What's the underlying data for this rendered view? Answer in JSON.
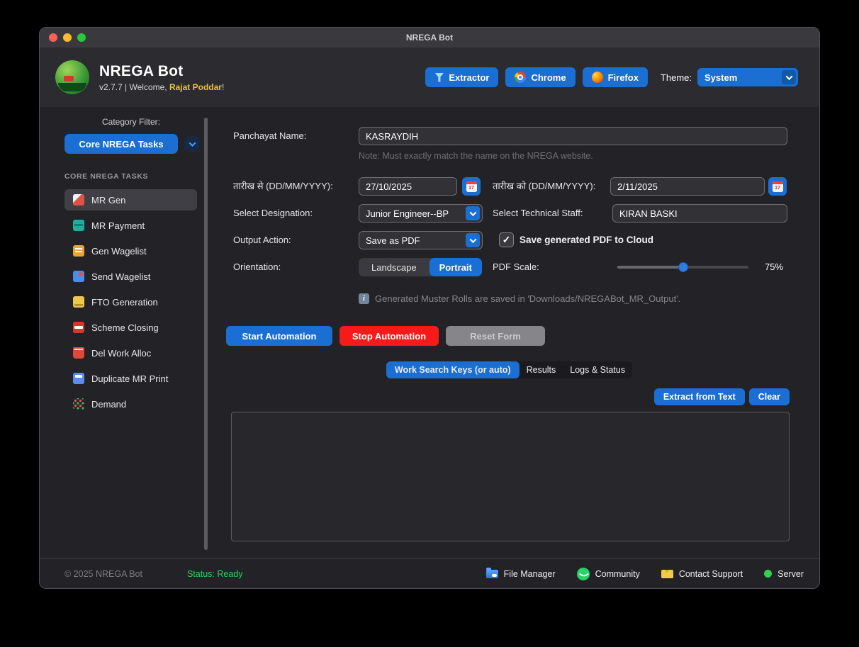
{
  "window": {
    "title": "NREGA Bot"
  },
  "header": {
    "app_name": "NREGA Bot",
    "welcome_prefix": "v2.7.7 | Welcome, ",
    "user_name": "Rajat Poddar",
    "welcome_suffix": "!",
    "extractor_button": "Extractor",
    "chrome_button": "Chrome",
    "firefox_button": "Firefox",
    "theme_label": "Theme:",
    "theme_value": "System"
  },
  "sidebar": {
    "filter_label": "Category Filter:",
    "filter_value": "Core NREGA Tasks",
    "section_header": "CORE NREGA TASKS",
    "items": [
      {
        "label": "MR Gen",
        "selected": true
      },
      {
        "label": "MR Payment",
        "selected": false
      },
      {
        "label": "Gen Wagelist",
        "selected": false
      },
      {
        "label": "Send Wagelist",
        "selected": false
      },
      {
        "label": "FTO Generation",
        "selected": false
      },
      {
        "label": "Scheme Closing",
        "selected": false
      },
      {
        "label": "Del Work Alloc",
        "selected": false
      },
      {
        "label": "Duplicate MR Print",
        "selected": false
      },
      {
        "label": "Demand",
        "selected": false
      }
    ]
  },
  "form": {
    "panchayat_label": "Panchayat Name:",
    "panchayat_value": "KASRAYDIH",
    "panchayat_note": "Note: Must exactly match the name on the NREGA website.",
    "date_from_label": "तारीख से (DD/MM/YYYY):",
    "date_from_value": "27/10/2025",
    "date_to_label": "तारीख को (DD/MM/YYYY):",
    "date_to_value": "2/11/2025",
    "designation_label": "Select Designation:",
    "designation_value": "Junior Engineer--BP",
    "staff_label": "Select Technical Staff:",
    "staff_value": "KIRAN BASKI",
    "output_label": "Output Action:",
    "output_value": "Save as PDF",
    "cloud_checkbox_label": "Save generated PDF to Cloud",
    "cloud_checkbox_checked": true,
    "check_glyph": "✓",
    "orientation_label": "Orientation:",
    "landscape_option": "Landscape",
    "portrait_option": "Portrait",
    "orientation_selected": "Portrait",
    "pdf_scale_label": "PDF Scale:",
    "pdf_scale_value": "75%",
    "pdf_scale_percent": 75,
    "info_icon_glyph": "i",
    "info_note": "Generated Muster Rolls are saved in 'Downloads/NREGABot_MR_Output'."
  },
  "actions": {
    "start": "Start Automation",
    "stop": "Stop Automation",
    "reset": "Reset Form"
  },
  "tabs": [
    {
      "label": "Work Search Keys (or auto)",
      "selected": true
    },
    {
      "label": "Results",
      "selected": false
    },
    {
      "label": "Logs & Status",
      "selected": false
    }
  ],
  "workspace": {
    "extract_button": "Extract from Text",
    "clear_button": "Clear",
    "textarea_value": ""
  },
  "footer": {
    "copyright": "© 2025 NREGA Bot",
    "status": "Status: Ready",
    "file_manager": "File Manager",
    "community": "Community",
    "contact_support": "Contact Support",
    "server": "Server"
  },
  "colors": {
    "accent_blue": "#1b6ed2",
    "danger_red": "#f61a1a",
    "status_green": "#2fcf5f",
    "user_gold": "#e6c23c"
  }
}
